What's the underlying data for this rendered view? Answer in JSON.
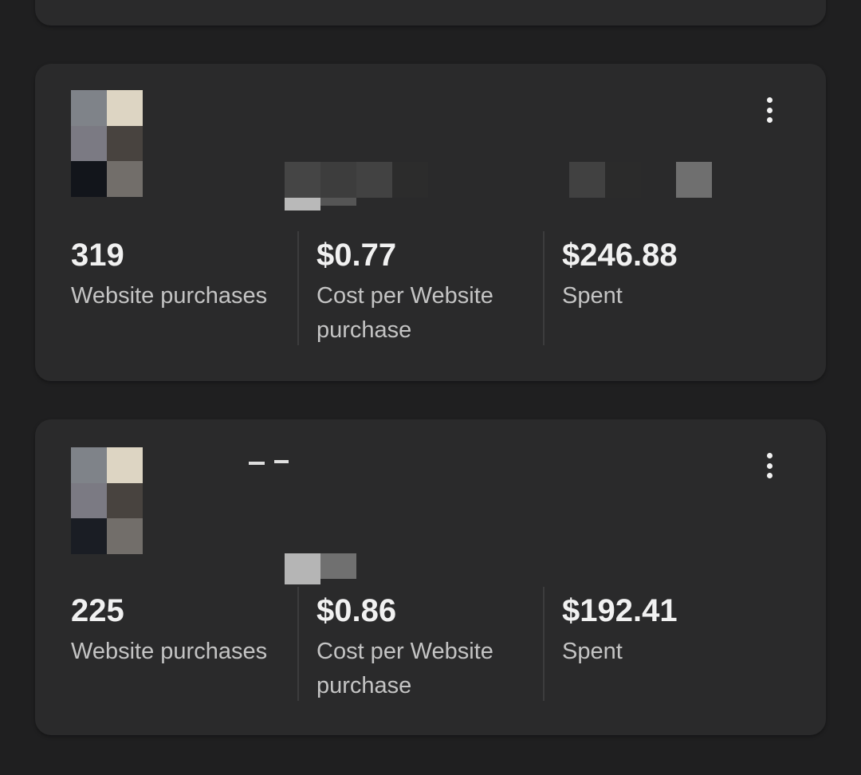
{
  "campaigns": [
    {
      "metrics": [
        {
          "value": "319",
          "label": "Website purchases"
        },
        {
          "value": "$0.77",
          "label": "Cost per Website purchase"
        },
        {
          "value": "$246.88",
          "label": "Spent"
        }
      ]
    },
    {
      "metrics": [
        {
          "value": "225",
          "label": "Website purchases"
        },
        {
          "value": "$0.86",
          "label": "Cost per Website purchase"
        },
        {
          "value": "$192.41",
          "label": "Spent"
        }
      ]
    }
  ],
  "colors": {
    "background": "#1f1f20",
    "card": "#2a2a2b",
    "value_text": "#f1f1f1",
    "label_text": "#c4c4c4"
  },
  "icons": {
    "menu": "more-vertical-icon"
  }
}
